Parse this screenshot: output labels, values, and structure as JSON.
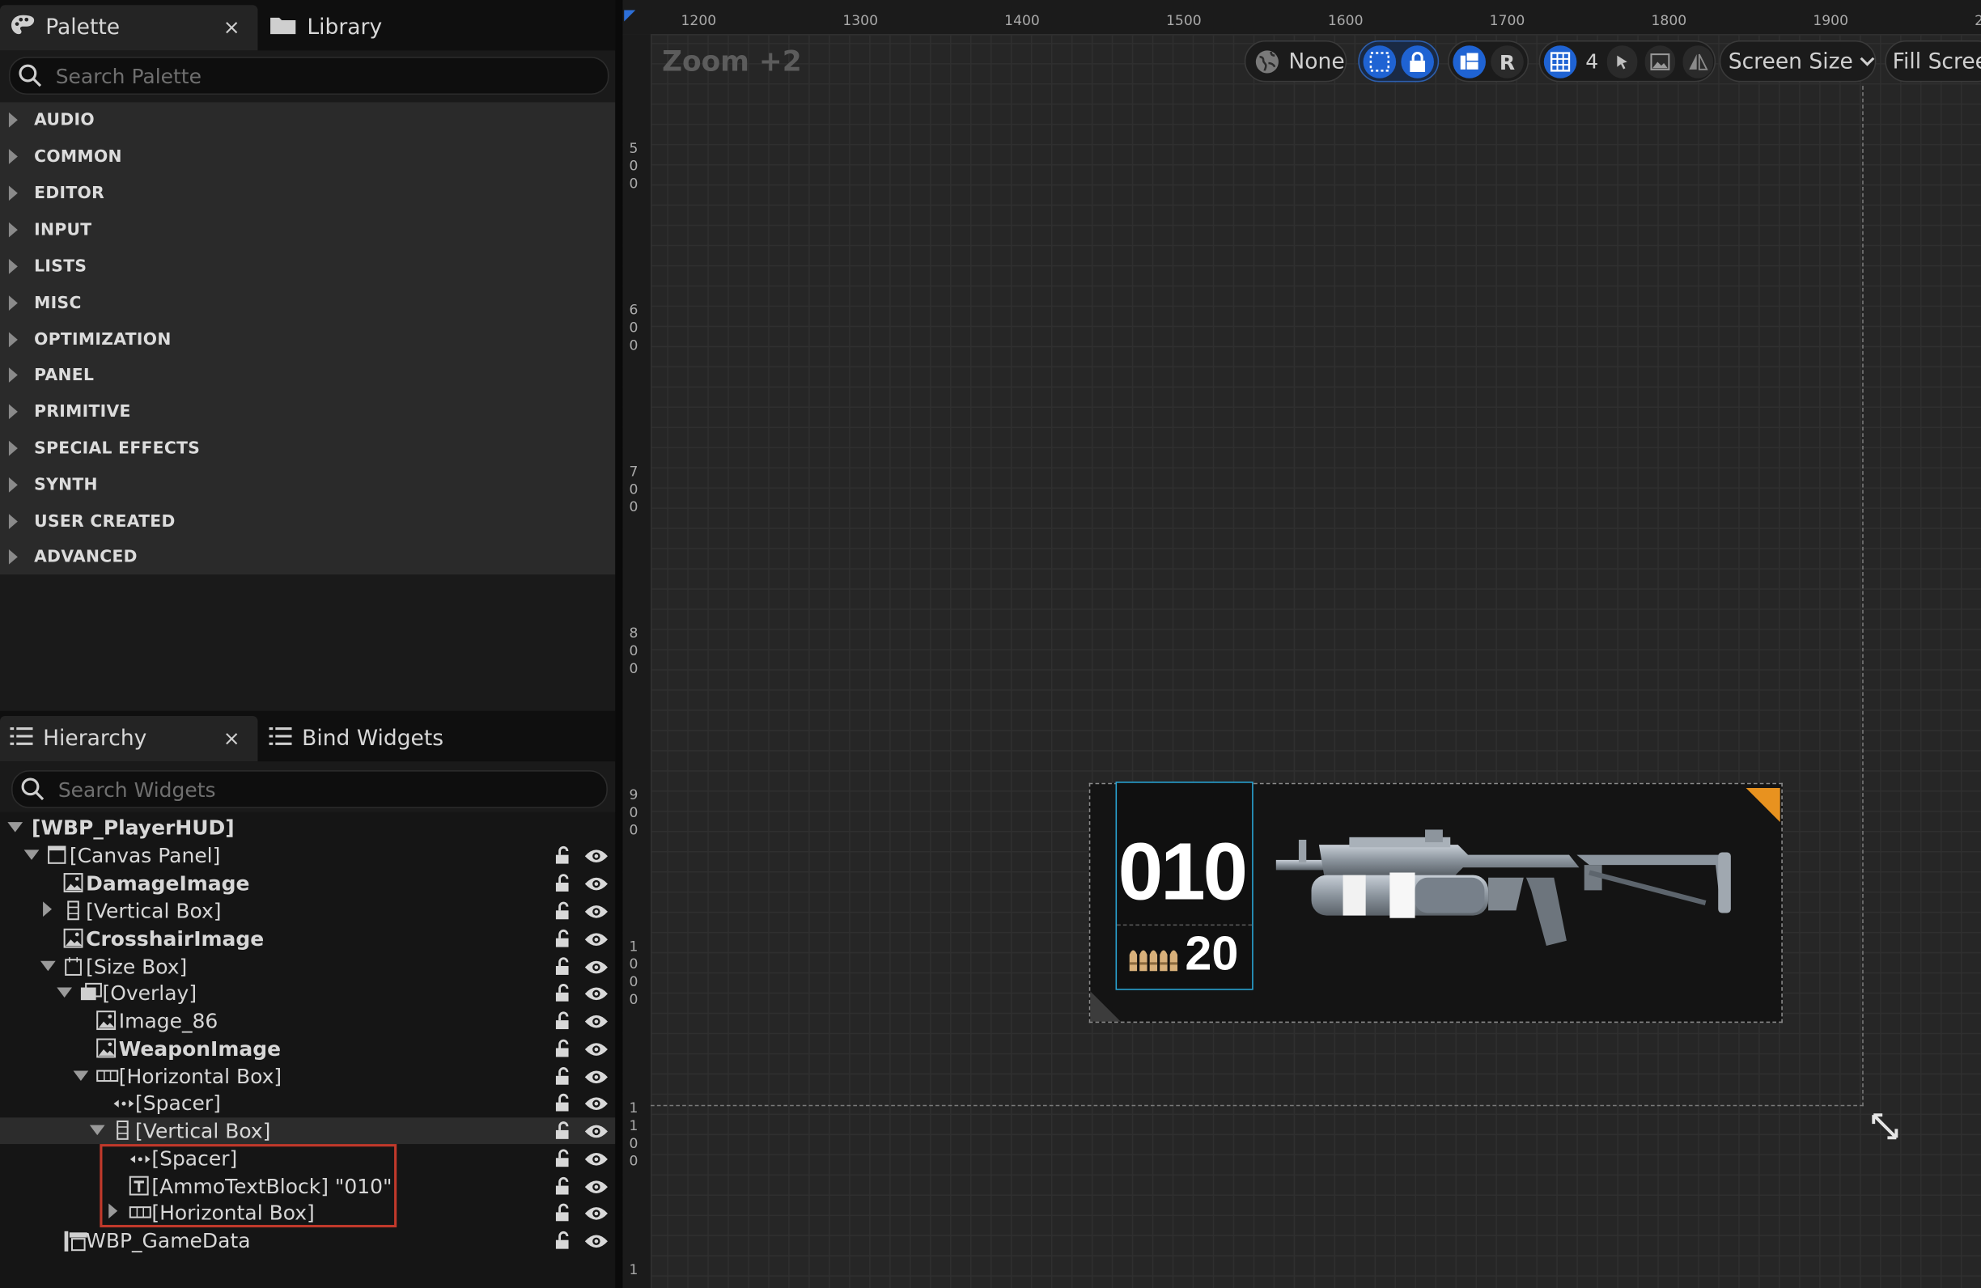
{
  "palette_panel": {
    "tab_palette": "Palette",
    "tab_library": "Library",
    "close": "×",
    "search_placeholder": "Search Palette",
    "categories": [
      "AUDIO",
      "COMMON",
      "EDITOR",
      "INPUT",
      "LISTS",
      "MISC",
      "OPTIMIZATION",
      "PANEL",
      "PRIMITIVE",
      "SPECIAL EFFECTS",
      "SYNTH",
      "USER CREATED",
      "ADVANCED"
    ]
  },
  "hierarchy_panel": {
    "tab_hierarchy": "Hierarchy",
    "tab_bind": "Bind Widgets",
    "close": "×",
    "search_placeholder": "Search Widgets",
    "items": [
      {
        "label": "[WBP_PlayerHUD]",
        "bold": true,
        "expander": "down",
        "icon": "none"
      },
      {
        "label": "[Canvas Panel]",
        "bold": false,
        "expander": "down",
        "icon": "canvas-icon"
      },
      {
        "label": "DamageImage",
        "bold": true,
        "expander": "none",
        "icon": "image-icon"
      },
      {
        "label": "[Vertical Box]",
        "bold": false,
        "expander": "right",
        "icon": "vertical-box-icon"
      },
      {
        "label": "CrosshairImage",
        "bold": true,
        "expander": "none",
        "icon": "image-icon"
      },
      {
        "label": "[Size Box]",
        "bold": false,
        "expander": "down",
        "icon": "size-box-icon"
      },
      {
        "label": "[Overlay]",
        "bold": false,
        "expander": "down",
        "icon": "overlay-icon"
      },
      {
        "label": "Image_86",
        "bold": false,
        "expander": "none",
        "icon": "image-icon"
      },
      {
        "label": "WeaponImage",
        "bold": true,
        "expander": "none",
        "icon": "image-icon"
      },
      {
        "label": "[Horizontal Box]",
        "bold": false,
        "expander": "down",
        "icon": "horizontal-box-icon"
      },
      {
        "label": "[Spacer]",
        "bold": false,
        "expander": "none",
        "icon": "spacer-icon"
      },
      {
        "label": "[Vertical Box]",
        "bold": false,
        "expander": "down",
        "icon": "vertical-box-icon"
      },
      {
        "label": "[Spacer]",
        "bold": false,
        "expander": "none",
        "icon": "spacer-icon"
      },
      {
        "label": "[AmmoTextBlock] \"010\"",
        "bold": false,
        "expander": "none",
        "icon": "text-icon"
      },
      {
        "label": "[Horizontal Box]",
        "bold": false,
        "expander": "right",
        "icon": "horizontal-box-icon"
      },
      {
        "label": "WBP_GameData",
        "bold": false,
        "expander": "none",
        "icon": "user-widget-icon"
      }
    ]
  },
  "designer": {
    "zoom_label": "Zoom +2",
    "ruler_top": [
      "1200",
      "1300",
      "1400",
      "1500",
      "1600",
      "1700",
      "1800",
      "1900",
      "2"
    ],
    "ruler_left": [
      "500",
      "600",
      "700",
      "800",
      "900",
      "1000",
      "1100",
      "1"
    ],
    "toolbar": {
      "localization": "None",
      "respect_locks": "R",
      "grid_snap": "4",
      "screen_size": "Screen Size",
      "fill_screen": "Fill Scree"
    },
    "hud": {
      "ammo": "010",
      "magazines": "20"
    }
  },
  "colors": {
    "accent_blue": "#1f63d3",
    "selection_cyan": "#2aa6d6",
    "highlight_red": "#c0392b",
    "hud_orange": "#e8921f"
  }
}
